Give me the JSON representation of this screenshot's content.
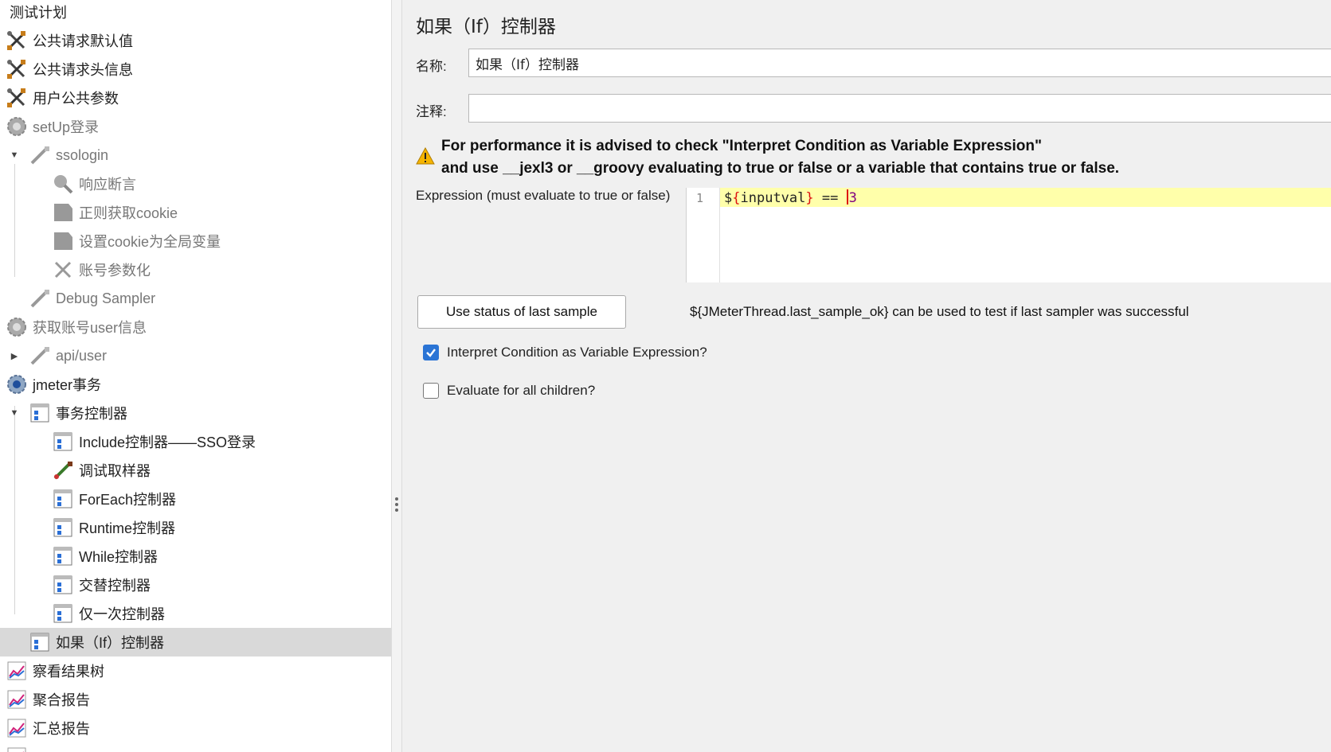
{
  "tree": {
    "items": [
      {
        "label": "测试计划",
        "icon": "test-plan-icon"
      },
      {
        "label": "公共请求默认值",
        "icon": "config-element-icon"
      },
      {
        "label": "公共请求头信息",
        "icon": "config-element-icon"
      },
      {
        "label": "用户公共参数",
        "icon": "config-element-icon"
      },
      {
        "label": "setUp登录",
        "icon": "setup-thread-group-icon"
      },
      {
        "label": "ssologin",
        "icon": "sampler-icon"
      },
      {
        "label": "响应断言",
        "icon": "assertion-icon"
      },
      {
        "label": "正则获取cookie",
        "icon": "post-processor-icon"
      },
      {
        "label": "设置cookie为全局变量",
        "icon": "post-processor-icon"
      },
      {
        "label": "账号参数化",
        "icon": "config-element-icon"
      },
      {
        "label": "Debug Sampler",
        "icon": "sampler-icon"
      },
      {
        "label": "获取账号user信息",
        "icon": "thread-group-icon"
      },
      {
        "label": "api/user",
        "icon": "sampler-icon"
      },
      {
        "label": "jmeter事务",
        "icon": "thread-group-icon"
      },
      {
        "label": "事务控制器",
        "icon": "controller-icon"
      },
      {
        "label": "Include控制器——SSO登录",
        "icon": "controller-icon"
      },
      {
        "label": "调试取样器",
        "icon": "sampler-icon"
      },
      {
        "label": "ForEach控制器",
        "icon": "controller-icon"
      },
      {
        "label": "Runtime控制器",
        "icon": "controller-icon"
      },
      {
        "label": "While控制器",
        "icon": "controller-icon"
      },
      {
        "label": "交替控制器",
        "icon": "controller-icon"
      },
      {
        "label": "仅一次控制器",
        "icon": "controller-icon"
      },
      {
        "label": "如果（If）控制器",
        "icon": "controller-icon"
      },
      {
        "label": "察看结果树",
        "icon": "listener-icon"
      },
      {
        "label": "聚合报告",
        "icon": "listener-icon"
      },
      {
        "label": "汇总报告",
        "icon": "listener-icon"
      },
      {
        "label": "",
        "icon": "listener-icon"
      }
    ]
  },
  "panel": {
    "title": "如果（If）控制器",
    "name_label": "名称:",
    "name_value": "如果（If）控制器",
    "comment_label": "注释:",
    "comment_value": "",
    "warning_line1": "For performance it is advised to check \"Interpret Condition as Variable Expression\"",
    "warning_line2": "and use __jexl3 or __groovy evaluating to true or false or a variable that contains true or false.",
    "expression_label": "Expression (must evaluate to true or false)",
    "editor": {
      "line_number": "1",
      "code_prefix": "$",
      "code_open": "{",
      "code_var": "inputval",
      "code_close": "}",
      "code_op": " == ",
      "code_value": "3"
    },
    "status_button": "Use status of last sample",
    "status_hint": "${JMeterThread.last_sample_ok} can be used to test if last sampler was successful",
    "interpret_label": "Interpret Condition as Variable Expression?",
    "interpret_checked": true,
    "evaluate_label": "Evaluate for all children?",
    "evaluate_checked": false
  },
  "colors": {
    "selection": "#d9d9d9",
    "checkbox_accent": "#2a74d5",
    "editor_line_highlight": "#ffffaa",
    "warning": "#f5b400"
  }
}
